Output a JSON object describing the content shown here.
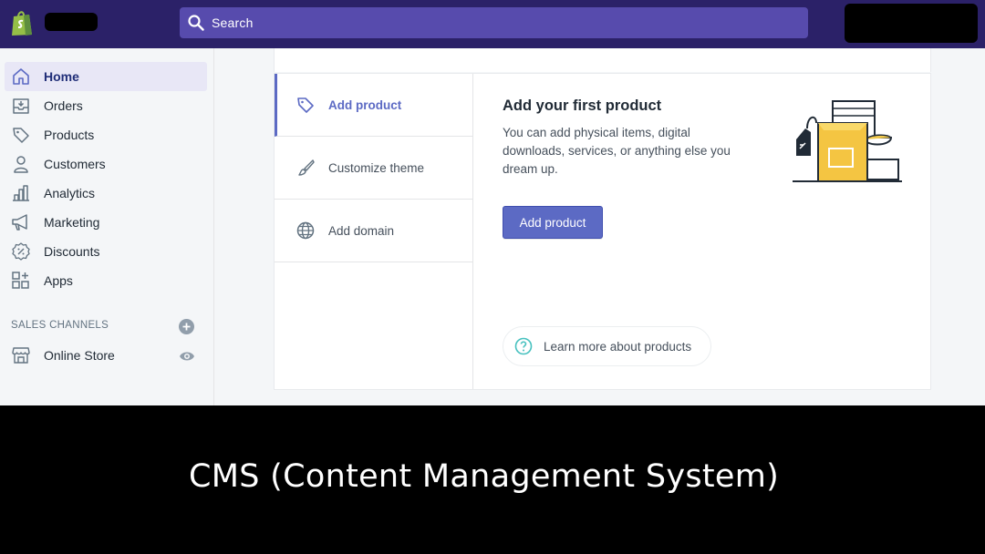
{
  "colors": {
    "topbar": "#2b2168",
    "search_bg": "#574bad",
    "accent": "#5c6ac4",
    "logo_green": "#95bf47"
  },
  "topbar": {
    "logo_icon": "shopify-bag-icon",
    "search": {
      "placeholder": "Search",
      "icon": "search-icon"
    }
  },
  "sidebar": {
    "items": [
      {
        "label": "Home",
        "icon": "home-icon",
        "active": true
      },
      {
        "label": "Orders",
        "icon": "orders-icon"
      },
      {
        "label": "Products",
        "icon": "tag-icon"
      },
      {
        "label": "Customers",
        "icon": "person-icon"
      },
      {
        "label": "Analytics",
        "icon": "bar-chart-icon"
      },
      {
        "label": "Marketing",
        "icon": "megaphone-icon"
      },
      {
        "label": "Discounts",
        "icon": "discount-icon"
      },
      {
        "label": "Apps",
        "icon": "apps-icon"
      }
    ],
    "sales_channels": {
      "title": "SALES CHANNELS",
      "add_icon": "plus-circle-icon",
      "items": [
        {
          "label": "Online Store",
          "icon": "store-icon",
          "action_icon": "eye-icon"
        }
      ]
    }
  },
  "main": {
    "tabs": [
      {
        "label": "Add product",
        "icon": "tag-icon",
        "active": true
      },
      {
        "label": "Customize theme",
        "icon": "paintbrush-icon"
      },
      {
        "label": "Add domain",
        "icon": "globe-icon"
      }
    ],
    "panel": {
      "title": "Add your first product",
      "description": "You can add physical items, digital downloads, services, or anything else you dream up.",
      "button_label": "Add product",
      "learn_more": "Learn more about products",
      "learn_icon": "help-circle-icon",
      "illustration": "product-box-illustration"
    }
  },
  "caption": {
    "text": "CMS (Content Management System)"
  }
}
